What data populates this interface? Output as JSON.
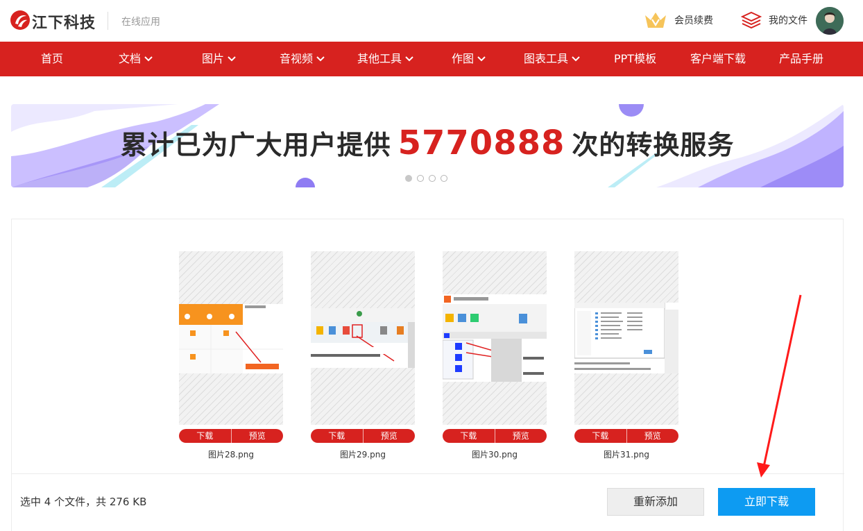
{
  "header": {
    "brand": "江下科技",
    "subtitle": "在线应用",
    "vip_label": "会员续费",
    "files_label": "我的文件"
  },
  "nav": [
    {
      "label": "首页",
      "dropdown": false
    },
    {
      "label": "文档",
      "dropdown": true
    },
    {
      "label": "图片",
      "dropdown": true
    },
    {
      "label": "音视频",
      "dropdown": true
    },
    {
      "label": "其他工具",
      "dropdown": true
    },
    {
      "label": "作图",
      "dropdown": true
    },
    {
      "label": "图表工具",
      "dropdown": true
    },
    {
      "label": "PPT模板",
      "dropdown": false
    },
    {
      "label": "客户端下载",
      "dropdown": false
    },
    {
      "label": "产品手册",
      "dropdown": false
    }
  ],
  "banner": {
    "prefix": "累计已为广大用户提供",
    "count": "5770888",
    "suffix": "次的转换服务",
    "slide_count": 4,
    "active_slide": 1
  },
  "files": [
    {
      "name": "图片28.png",
      "download_label": "下载",
      "preview_label": "预览"
    },
    {
      "name": "图片29.png",
      "download_label": "下载",
      "preview_label": "预览"
    },
    {
      "name": "图片30.png",
      "download_label": "下载",
      "preview_label": "预览"
    },
    {
      "name": "图片31.png",
      "download_label": "下载",
      "preview_label": "预览"
    }
  ],
  "summary": "选中 4 个文件，共 276 KB",
  "actions": {
    "readd_label": "重新添加",
    "download_label": "立即下载"
  },
  "colors": {
    "brand_red": "#d7221f",
    "primary_blue": "#0d9bf2",
    "banner_purple": "#9b8cf5"
  }
}
